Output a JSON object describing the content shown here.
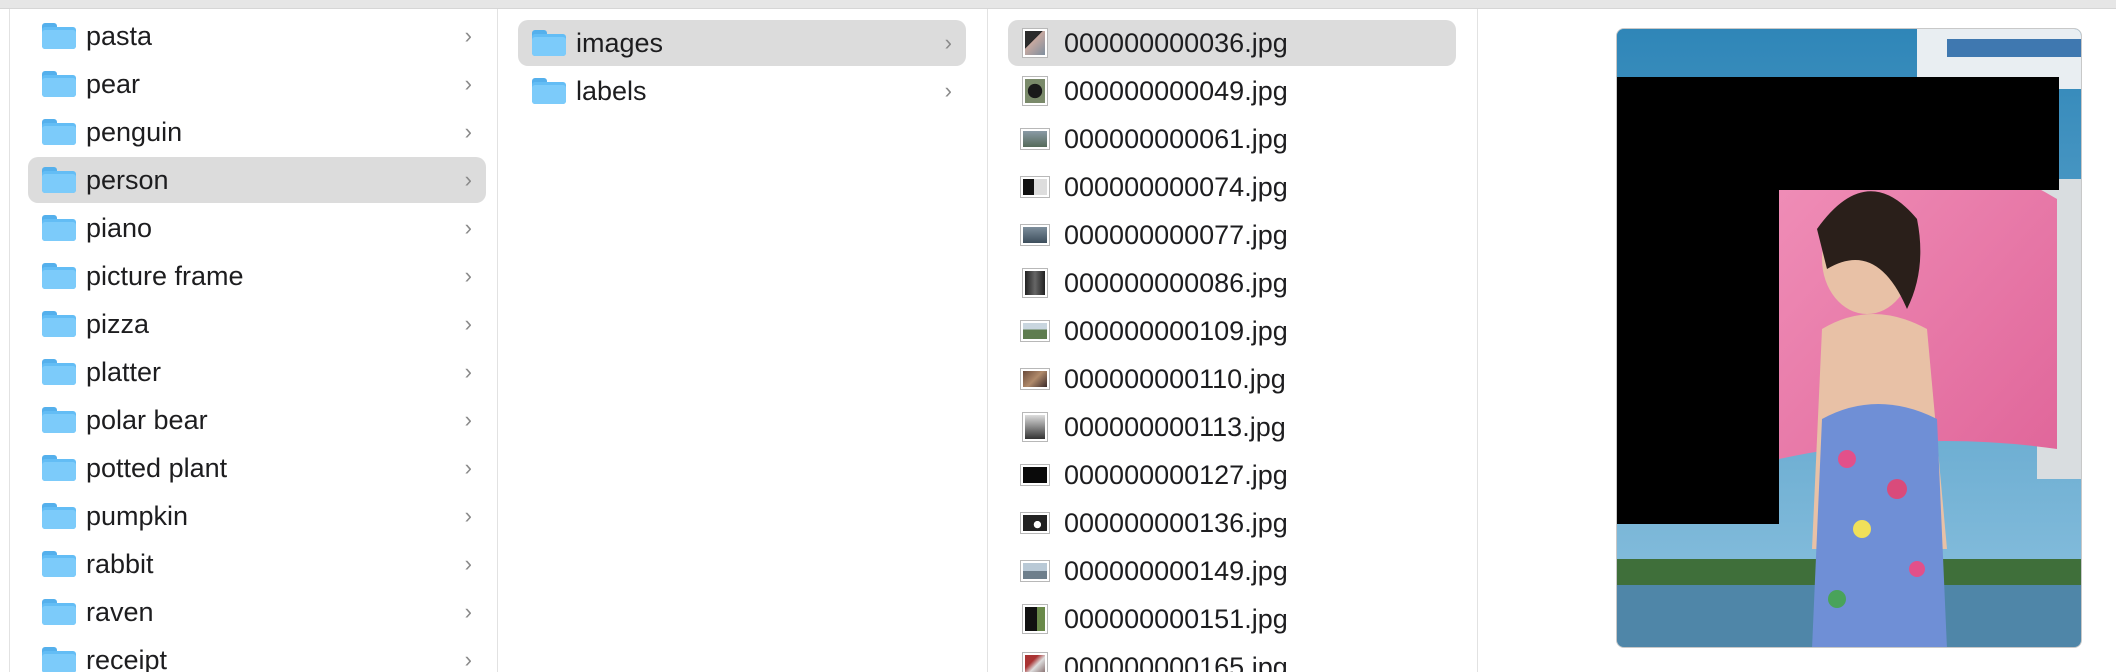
{
  "column1": {
    "items": [
      {
        "label": "pasta"
      },
      {
        "label": "pear"
      },
      {
        "label": "penguin"
      },
      {
        "label": "person",
        "selected": true
      },
      {
        "label": "piano"
      },
      {
        "label": "picture frame"
      },
      {
        "label": "pizza"
      },
      {
        "label": "platter"
      },
      {
        "label": "polar bear"
      },
      {
        "label": "potted plant"
      },
      {
        "label": "pumpkin"
      },
      {
        "label": "rabbit"
      },
      {
        "label": "raven"
      },
      {
        "label": "receipt"
      }
    ]
  },
  "column2": {
    "items": [
      {
        "label": "images",
        "selected": true
      },
      {
        "label": "labels"
      }
    ]
  },
  "column3": {
    "items": [
      {
        "label": "000000000036.jpg",
        "selected": true
      },
      {
        "label": "000000000049.jpg"
      },
      {
        "label": "000000000061.jpg"
      },
      {
        "label": "000000000074.jpg"
      },
      {
        "label": "000000000077.jpg"
      },
      {
        "label": "000000000086.jpg"
      },
      {
        "label": "000000000109.jpg"
      },
      {
        "label": "000000000110.jpg"
      },
      {
        "label": "000000000113.jpg"
      },
      {
        "label": "000000000127.jpg"
      },
      {
        "label": "000000000136.jpg"
      },
      {
        "label": "000000000149.jpg"
      },
      {
        "label": "000000000151.jpg"
      },
      {
        "label": "000000000165.jpg"
      }
    ]
  },
  "colors": {
    "selection": "#dcdcdc",
    "folder": "#7ccbfa",
    "chevron": "#8a8a8a"
  }
}
